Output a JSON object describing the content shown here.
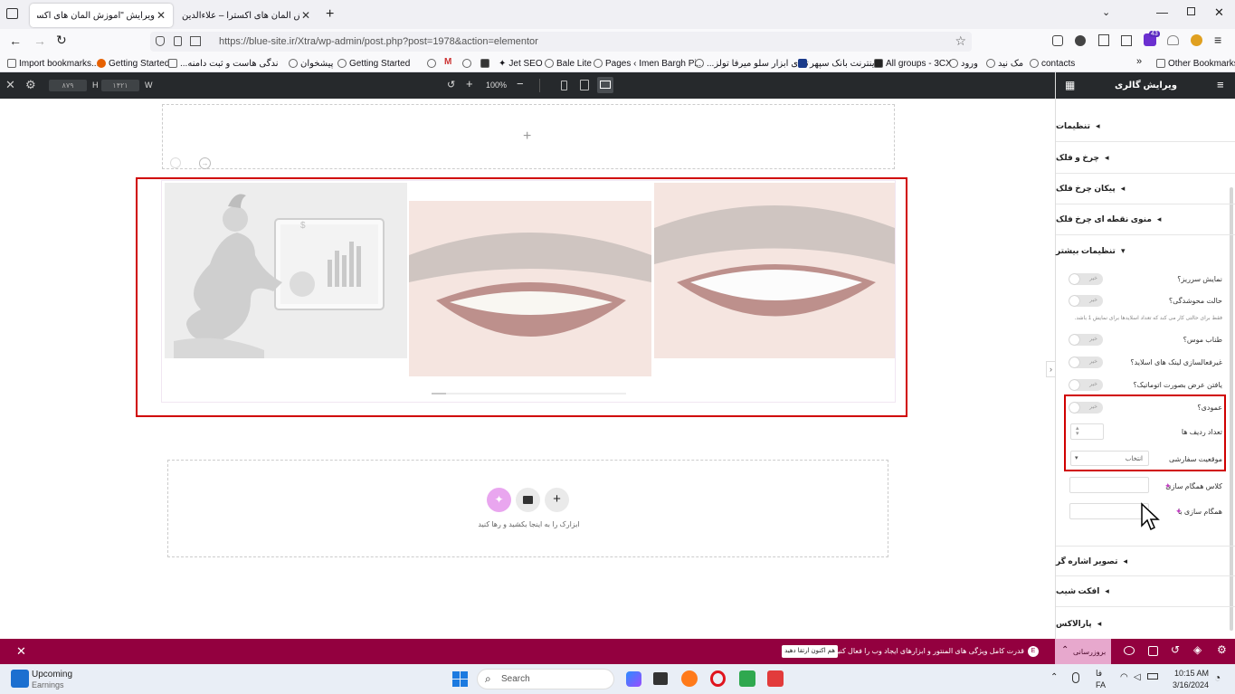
{
  "browser": {
    "tabs": [
      {
        "label": "ویرایش \"آموزش المان های اکسترا - ..."
      },
      {
        "label": "آموزش المان های اکسترا – علاءالدین"
      }
    ],
    "url": "https://blue-site.ir/Xtra/wp-admin/post.php?post=1978&action=elementor",
    "bookmarks": [
      "Import bookmarks...",
      "Getting Started",
      "...ندگی هاست و ثبت دامنه",
      "پیشخوان",
      "Getting Started",
      "Jet SEO",
      "Bale Lite",
      "Pages ‹ Imen Bargh Pi...",
      "...تمای ابزار سلو میرفا تولز",
      "اینترنت بانک سپهر",
      "All groups - 3CX",
      "ورود",
      "مک نید",
      "contacts"
    ],
    "other_bookmarks": "Other Bookmarks",
    "profile_badge": "43"
  },
  "editor": {
    "width_label": "W",
    "height_label": "H",
    "width_value": "۱۴۲۱",
    "height_value": "۸۷۹",
    "zoom": "100%",
    "plus_label": "+",
    "minus_label": "−",
    "drop_text": "ابزارک را به اینجا بکشید و رها کنید"
  },
  "panel": {
    "title": "ویرایش گالری",
    "sections": [
      "تنظیمات",
      "چرخ و فلک",
      "پیکان چرخ فلک",
      "منوی نقطه ای چرخ فلک",
      "تنظیمات بیشتر",
      "تصویر اشاره گر",
      "افکت شیب",
      "پارالاکس"
    ],
    "controls": {
      "show_overflow": "نمایش سرریز؟",
      "fade_mode": "حالت محوشدگی؟",
      "fade_note": "فقط برای حالتی کار می کند که تعداد اسلایدها برای نمایش 1 باشد.",
      "mouse_drag": "طناب موس؟",
      "disable_links": "غیرفعالسازی لینک های اسلاید؟",
      "auto_width": "یافتن عرض بصورت اتوماتیک؟",
      "vertical": "عمودی؟",
      "rows": "تعداد ردیف ها",
      "custom_position": "موقعیت سفارشی",
      "custom_position_value": "انتخاب",
      "sync_class": "کلاس همگام سازی",
      "sync_with": "همگام سازی با",
      "toggle_no": "خیر"
    }
  },
  "notice": {
    "text": "قدرت کامل ویژگی های المنتور و ابزارهای ایجاد وب را فعال کنید.",
    "button": "هم اکنون ارتقا دهید",
    "update_label": "بروزرسانی"
  },
  "taskbar": {
    "weather_title": "Upcoming",
    "weather_sub": "Earnings",
    "search": "Search",
    "lang1": "فا",
    "lang2": "FA",
    "time": "10:15 AM",
    "date": "3/16/2024"
  },
  "colors": {
    "notice_bg": "#93003f",
    "highlight": "#d00000",
    "editor_bar": "#26292c",
    "ai_pink": "#e9a6ef"
  }
}
